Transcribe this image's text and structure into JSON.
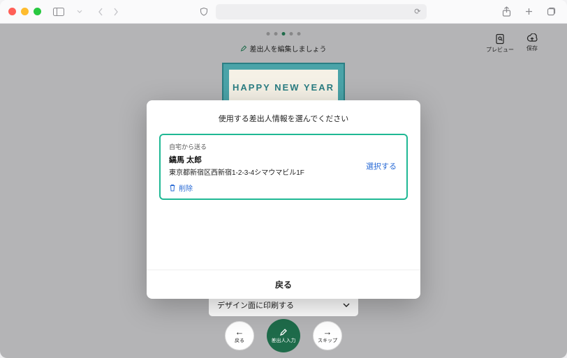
{
  "toolbar": {
    "address_refresh_glyph": "⟳"
  },
  "app": {
    "hint": "差出人を編集しましょう",
    "preview_label": "プレビュー",
    "save_label": "保存",
    "card_text": "HAPPY NEW YEAR",
    "dropdown_label": "デザイン面に印刷する",
    "nav_back": "戻る",
    "nav_primary": "差出人入力",
    "nav_skip": "スキップ"
  },
  "modal": {
    "title": "使用する差出人情報を選んでください",
    "sender": {
      "tag": "自宅から送る",
      "name": "縞馬 太郎",
      "address": "東京都新宿区西新宿1-2-3-4シマウマビル1F",
      "select": "選択する",
      "delete": "削除"
    },
    "back": "戻る"
  }
}
